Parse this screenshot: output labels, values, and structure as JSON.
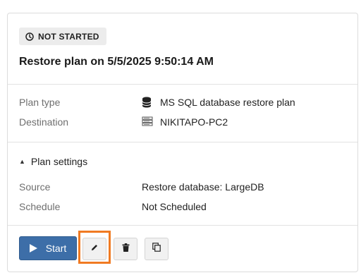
{
  "status": {
    "badge_label": "NOT STARTED",
    "icon": "clock-icon"
  },
  "plan": {
    "title": "Restore plan on 5/5/2025 9:50:14 AM"
  },
  "details": [
    {
      "label": "Plan type",
      "value": "MS SQL database restore plan",
      "icon": "database-icon"
    },
    {
      "label": "Destination",
      "value": "NIKITAPO-PC2",
      "icon": "server-icon"
    }
  ],
  "settings": {
    "toggle_label": "Plan settings",
    "rows": [
      {
        "label": "Source",
        "value": "Restore database: LargeDB"
      },
      {
        "label": "Schedule",
        "value": "Not Scheduled"
      }
    ]
  },
  "actions": {
    "start_label": "Start",
    "edit_icon": "pencil-icon",
    "delete_icon": "trash-icon",
    "copy_icon": "copy-icon"
  },
  "colors": {
    "primary": "#3d6ea8",
    "highlight": "#f07a22"
  }
}
